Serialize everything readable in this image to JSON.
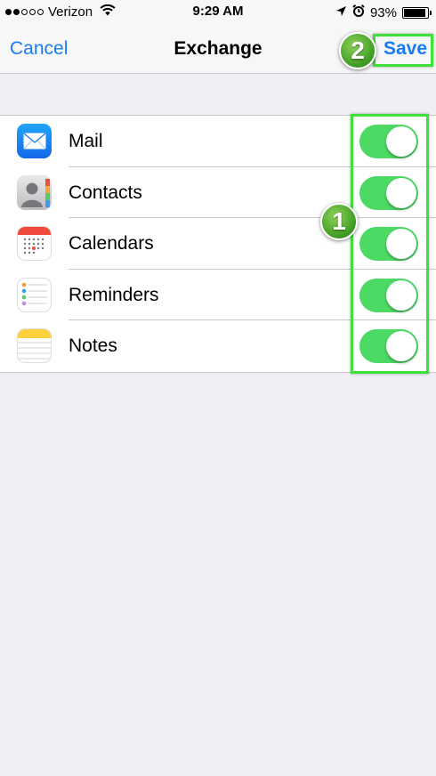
{
  "status_bar": {
    "carrier": "Verizon",
    "signal_bars_filled": 2,
    "signal_bars_total": 5,
    "time": "9:29 AM",
    "battery": "93%",
    "battery_level": 0.93
  },
  "nav": {
    "cancel": "Cancel",
    "title": "Exchange",
    "save": "Save"
  },
  "annotations": {
    "step1": "1",
    "step2": "2",
    "highlight_color": "#3fe03a"
  },
  "accent_color": "#1a7cf5",
  "toggle_on_color": "#4cd964",
  "items": [
    {
      "label": "Mail",
      "icon": "mail-icon",
      "enabled": true
    },
    {
      "label": "Contacts",
      "icon": "contacts-icon",
      "enabled": true
    },
    {
      "label": "Calendars",
      "icon": "calendar-icon",
      "enabled": true
    },
    {
      "label": "Reminders",
      "icon": "reminders-icon",
      "enabled": true
    },
    {
      "label": "Notes",
      "icon": "notes-icon",
      "enabled": true
    }
  ]
}
